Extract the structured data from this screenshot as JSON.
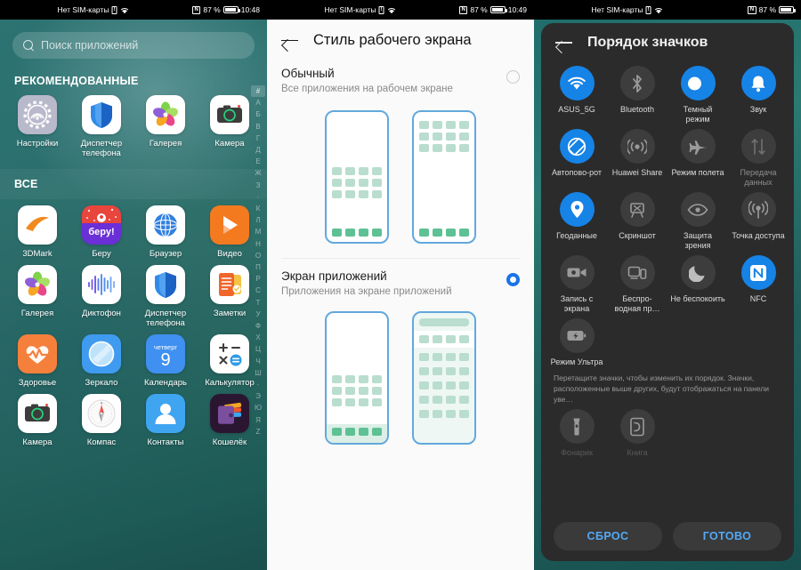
{
  "statusbar": {
    "sim_text": "Нет SIM-карты",
    "sim_badge": "!",
    "nfc_badge": "N",
    "battery_text": "87 %",
    "time_screen1": "10:48",
    "time_screen2": "10:49",
    "time_screen3": ""
  },
  "screen1": {
    "search": {
      "placeholder": "Поиск приложений"
    },
    "section_recommended": "РЕКОМЕНДОВАННЫЕ",
    "section_all": "ВСЕ",
    "recommended": [
      {
        "label": "Настройки",
        "icon": "settings-gear-icon"
      },
      {
        "label": "Диспетчер телефона",
        "icon": "phone-manager-shield-icon"
      },
      {
        "label": "Галерея",
        "icon": "gallery-flower-icon"
      },
      {
        "label": "Камера",
        "icon": "camera-icon"
      }
    ],
    "all_apps": [
      {
        "label": "3DMark",
        "icon": "3dmark-icon"
      },
      {
        "label": "Беру",
        "icon": "beru-icon"
      },
      {
        "label": "Браузер",
        "icon": "browser-globe-icon"
      },
      {
        "label": "Видео",
        "icon": "video-play-icon"
      },
      {
        "label": "Галерея",
        "icon": "gallery-flower-icon"
      },
      {
        "label": "Диктофон",
        "icon": "voice-recorder-icon"
      },
      {
        "label": "Диспетчер телефона",
        "icon": "phone-manager-shield-icon"
      },
      {
        "label": "Заметки",
        "icon": "notes-icon"
      },
      {
        "label": "Здоровье",
        "icon": "health-heart-icon"
      },
      {
        "label": "Зеркало",
        "icon": "mirror-icon"
      },
      {
        "label": "Календарь",
        "icon": "calendar-icon",
        "day_name": "четверг",
        "day_number": "9"
      },
      {
        "label": "Калькулятор",
        "icon": "calculator-icon"
      },
      {
        "label": "Камера",
        "icon": "camera-icon"
      },
      {
        "label": "Компас",
        "icon": "compass-icon"
      },
      {
        "label": "Контакты",
        "icon": "contacts-person-icon"
      },
      {
        "label": "Кошелёк",
        "icon": "wallet-icon"
      }
    ],
    "alpha_index": [
      "#",
      "А",
      "Б",
      "В",
      "Г",
      "Д",
      "Е",
      "Ж",
      "З",
      "·",
      "К",
      "Л",
      "М",
      "Н",
      "О",
      "П",
      "Р",
      "С",
      "Т",
      "У",
      "Ф",
      "Х",
      "Ц",
      "Ч",
      "Ш",
      "·",
      "Э",
      "Ю",
      "Я",
      "Z"
    ],
    "alpha_selected": "#"
  },
  "screen2": {
    "title": "Стиль рабочего экрана",
    "back_icon": "back-arrow-icon",
    "options": [
      {
        "title": "Обычный",
        "subtitle": "Все приложения на рабочем экране",
        "selected": false
      },
      {
        "title": "Экран приложений",
        "subtitle": "Приложения на экране приложений",
        "selected": true
      }
    ],
    "accent": "#1a73e8"
  },
  "screen3": {
    "title": "Порядок значков",
    "back_icon": "back-arrow-icon",
    "hint": "Перетащите значки, чтобы изменить их порядок. Значки, расположенные выше других, будут отображаться на панели уве…",
    "accent_on": "#1683e6",
    "toggles": [
      {
        "label": "ASUS_5G",
        "icon": "wifi-icon",
        "state": "on"
      },
      {
        "label": "Bluetooth",
        "icon": "bluetooth-icon",
        "state": "off"
      },
      {
        "label": "Темный режим",
        "icon": "dark-mode-icon",
        "state": "on"
      },
      {
        "label": "Звук",
        "icon": "sound-bell-icon",
        "state": "on"
      },
      {
        "label": "Автопово-рот",
        "icon": "auto-rotate-icon",
        "state": "on"
      },
      {
        "label": "Huawei Share",
        "icon": "huawei-share-icon",
        "state": "off"
      },
      {
        "label": "Режим полета",
        "icon": "airplane-icon",
        "state": "off"
      },
      {
        "label": "Передача данных",
        "icon": "data-transfer-icon",
        "state": "disabled"
      },
      {
        "label": "Геоданные",
        "icon": "location-pin-icon",
        "state": "on"
      },
      {
        "label": "Скриншот",
        "icon": "screenshot-icon",
        "state": "off"
      },
      {
        "label": "Защита зрения",
        "icon": "eye-comfort-icon",
        "state": "off"
      },
      {
        "label": "Точка доступа",
        "icon": "hotspot-icon",
        "state": "off"
      },
      {
        "label": "Запись с экрана",
        "icon": "screen-record-icon",
        "state": "off"
      },
      {
        "label": "Беспро-водная пр…",
        "icon": "wireless-projection-icon",
        "state": "off"
      },
      {
        "label": "Не беспокоить",
        "icon": "do-not-disturb-moon-icon",
        "state": "off"
      },
      {
        "label": "NFC",
        "icon": "nfc-icon",
        "state": "on"
      },
      {
        "label": "Режим Ультра",
        "icon": "ultra-power-saving-icon",
        "state": "off"
      }
    ],
    "overflow_toggles": [
      {
        "label": "Фонарик",
        "icon": "flashlight-icon",
        "state": "off"
      },
      {
        "label": "Книга",
        "icon": "ereader-icon",
        "state": "off"
      }
    ],
    "buttons": {
      "reset": "СБРОС",
      "done": "ГОТОВО"
    }
  }
}
